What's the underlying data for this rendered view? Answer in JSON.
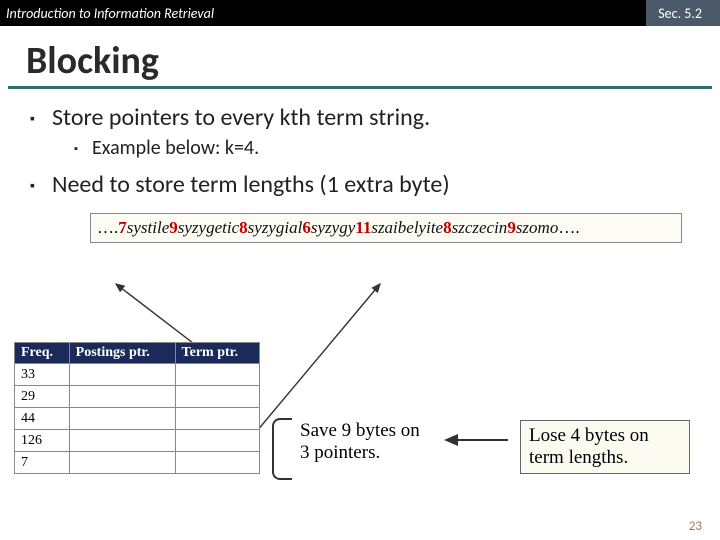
{
  "topbar": {
    "course": "Introduction to Information Retrieval",
    "section": "Sec. 5.2"
  },
  "title": "Blocking",
  "bullets": {
    "b1": "Store pointers to every kth term string.",
    "b1a": "Example below: k=4.",
    "b2": "Need to store term lengths (1 extra byte)"
  },
  "termstring": {
    "prefix": "….",
    "items": [
      {
        "len": "7",
        "word": "systile"
      },
      {
        "len": "9",
        "word": "syzygetic"
      },
      {
        "len": "8",
        "word": "syzygial"
      },
      {
        "len": "6",
        "word": "syzygy"
      },
      {
        "len": "11",
        "word": "szaibelyite"
      },
      {
        "len": "8",
        "word": "szczecin"
      },
      {
        "len": "9",
        "word": "szomo"
      }
    ],
    "suffix": "…."
  },
  "table": {
    "headers": {
      "h1": "Freq.",
      "h2": "Postings ptr.",
      "h3": "Term ptr."
    },
    "rows": [
      "33",
      "29",
      "44",
      "126",
      "7"
    ]
  },
  "notes": {
    "save": "Save 9 bytes on 3 pointers.",
    "lose": "Lose 4 bytes on term lengths."
  },
  "slidenum": "23"
}
